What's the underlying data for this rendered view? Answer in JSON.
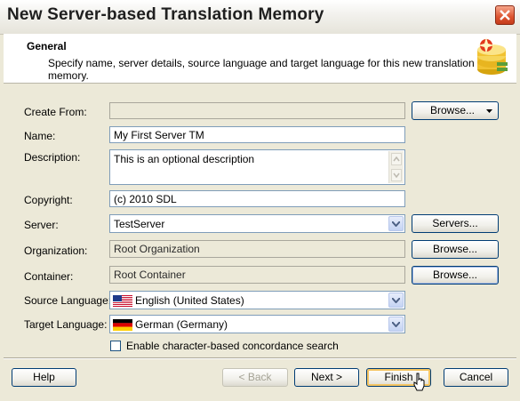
{
  "window": {
    "title": "New Server-based Translation Memory",
    "close_icon": "close-icon"
  },
  "header": {
    "title": "General",
    "description": "Specify name, server details, source language and target language for this new translation memory.",
    "icon": "database-star-icon"
  },
  "form": {
    "create_from": {
      "label": "Create From:",
      "value": "",
      "button": "Browse..."
    },
    "name": {
      "label": "Name:",
      "value": "My First Server TM"
    },
    "description": {
      "label": "Description:",
      "value": "This is an optional description"
    },
    "copyright": {
      "label": "Copyright:",
      "value": "(c) 2010 SDL"
    },
    "server": {
      "label": "Server:",
      "value": "TestServer",
      "button": "Servers..."
    },
    "organization": {
      "label": "Organization:",
      "value": "Root Organization",
      "button": "Browse..."
    },
    "container": {
      "label": "Container:",
      "value": "Root Container",
      "button": "Browse..."
    },
    "source_language": {
      "label": "Source Language:",
      "value": "English (United States)",
      "flag": "us-flag-icon"
    },
    "target_language": {
      "label": "Target Language:",
      "value": "German (Germany)",
      "flag": "de-flag-icon"
    },
    "concordance": {
      "label": "Enable character-based concordance search",
      "checked": false
    }
  },
  "footer": {
    "help": "Help",
    "back": "< Back",
    "next": "Next >",
    "finish": "Finish",
    "cancel": "Cancel"
  }
}
